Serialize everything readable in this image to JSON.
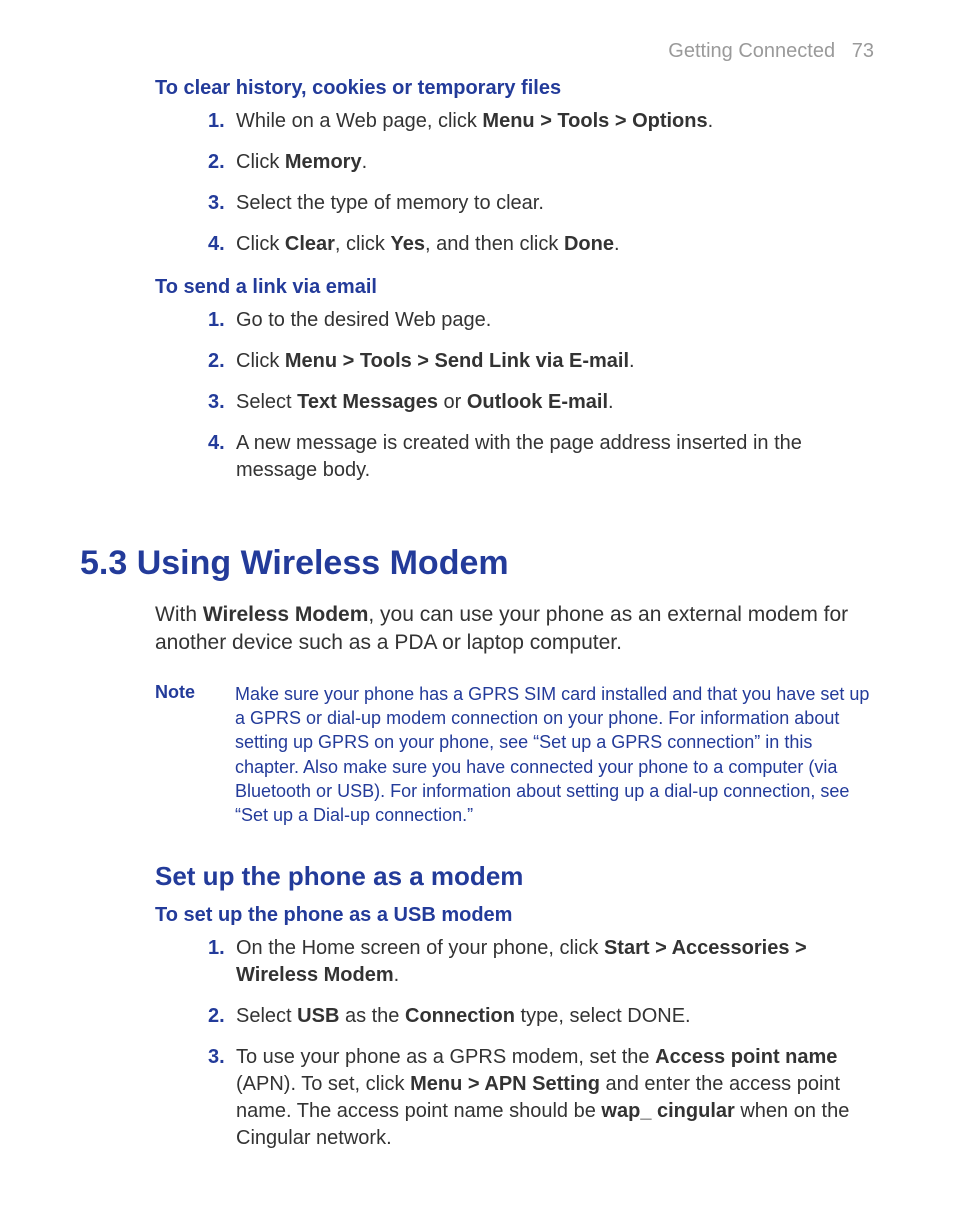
{
  "header": {
    "chapter": "Getting Connected",
    "page": "73"
  },
  "sec1": {
    "title": "To clear history, cookies or temporary files",
    "s1": {
      "pre": "While on a Web page, click ",
      "b": "Menu > Tools > Options",
      "post": "."
    },
    "s2": {
      "pre": "Click ",
      "b": "Memory",
      "post": "."
    },
    "s3": "Select the type of memory to clear.",
    "s4": {
      "a": "Click ",
      "b": "Clear",
      "c": ", click ",
      "d": "Yes",
      "e": ", and then click ",
      "f": "Done",
      "g": "."
    }
  },
  "sec2": {
    "title": "To send a link via email",
    "s1": "Go to the desired Web page.",
    "s2": {
      "pre": "Click ",
      "b": "Menu > Tools > Send Link via E-mail",
      "post": "."
    },
    "s3": {
      "a": "Select ",
      "b": "Text Messages",
      "c": " or ",
      "d": "Outlook E-mail",
      "e": "."
    },
    "s4": "A new message is created with the page address inserted in the message body."
  },
  "sec3": {
    "title": "5.3 Using Wireless Modem",
    "intro": {
      "a": "With ",
      "b": "Wireless Modem",
      "c": ", you can use your phone as an external modem for another device such as a PDA or laptop computer."
    },
    "noteLabel": "Note",
    "noteText": "Make sure your phone has a GPRS SIM card installed and that you have set up a GPRS or dial-up modem connection on your phone. For information about setting up GPRS on your phone, see “Set up a GPRS connection” in this chapter. Also make sure you have connected your phone to a computer (via Bluetooth or USB). For information about setting up a dial-up connection, see “Set up a Dial-up connection.”",
    "subhead": "Set up the phone as a modem",
    "usbTitle": "To set up the phone as a USB modem",
    "u1": {
      "a": "On the Home screen of your phone, click ",
      "b": "Start > Accessories > Wireless Modem",
      "c": "."
    },
    "u2": {
      "a": "Select ",
      "b": "USB",
      "c": " as the ",
      "d": "Connection",
      "e": " type, select DONE."
    },
    "u3": {
      "a": "To use your phone as a GPRS modem, set the ",
      "b": "Access point name",
      "c": " (APN). To set, click ",
      "d": "Menu > APN Setting",
      "e": " and enter the access point name. The access point name should be ",
      "f": "wap_ cingular",
      "g": " when on the Cingular network."
    }
  }
}
